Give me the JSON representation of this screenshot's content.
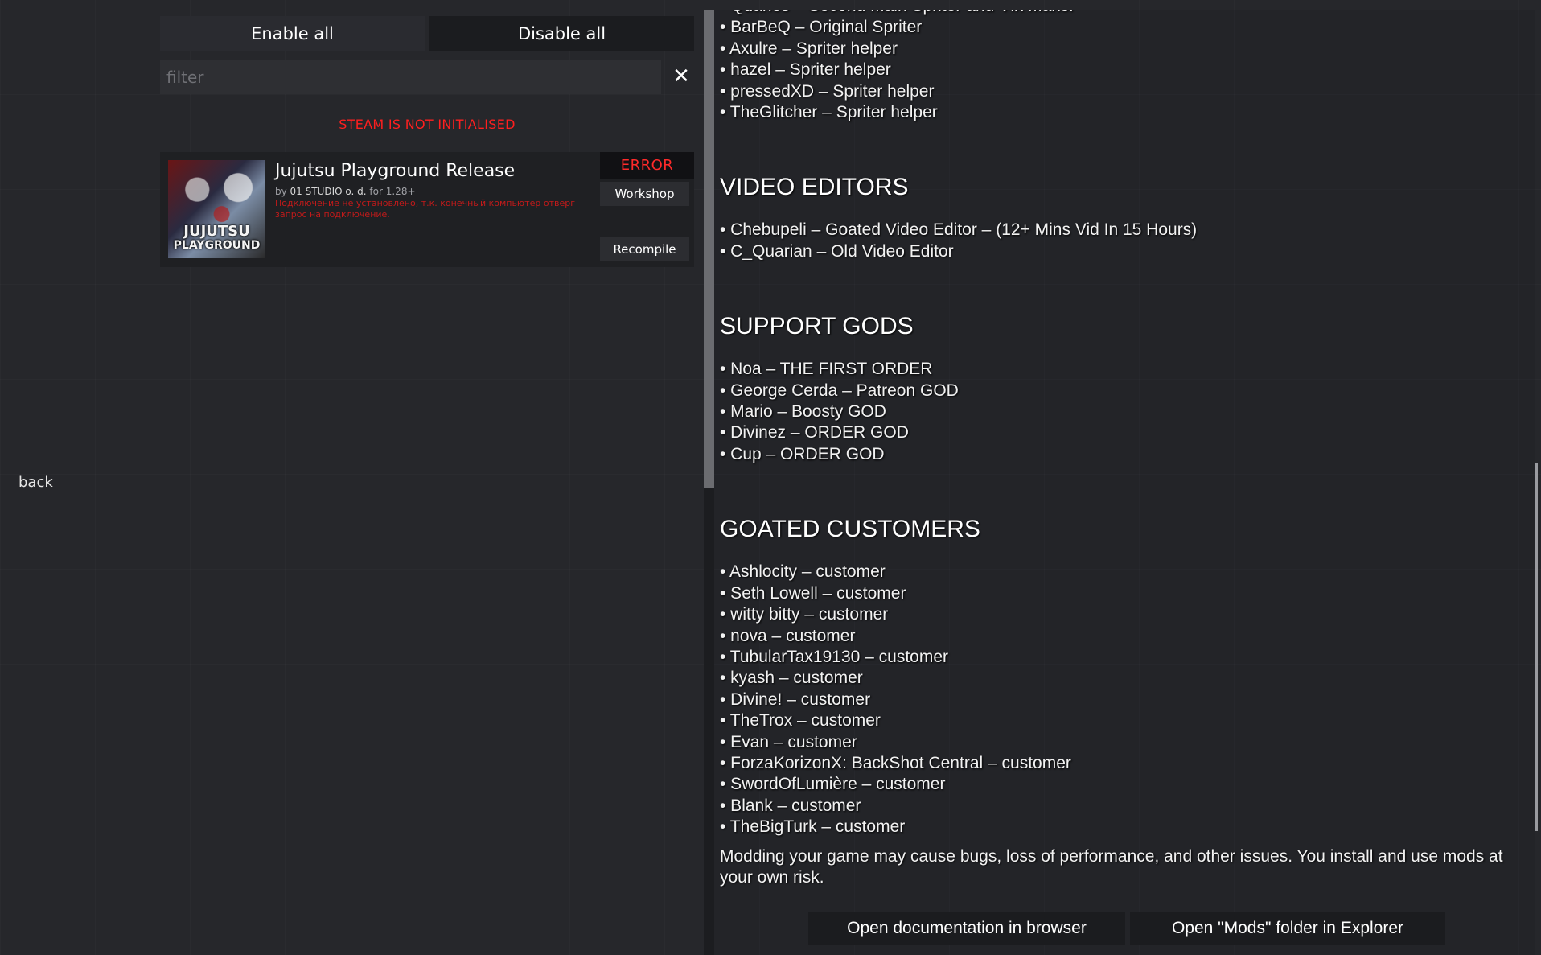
{
  "nav": {
    "back_label": "back"
  },
  "toolbar": {
    "enable_all": "Enable all",
    "disable_all": "Disable all"
  },
  "filter": {
    "placeholder": "filter",
    "clear_icon": "✕"
  },
  "steam_status": "STEAM IS NOT INITIALISED",
  "mod": {
    "title": "Jujutsu Playground Release",
    "by_prefix": "by",
    "author": "01 STUDIO o. d.",
    "version_note": "for 1.28+",
    "error_message": "Подключение не установлено, т.к. конечный компьютер отверг запрос на подключение.",
    "status_badge": "ERROR",
    "workshop_label": "Workshop",
    "recompile_label": "Recompile",
    "thumbnail_text_1": "JUJUTSU",
    "thumbnail_text_2": "PLAYGROUND",
    "thumbnail_icon": "mod-thumbnail-image"
  },
  "credits": {
    "top_lines": [
      "• Quaries – Second Main Spriter and Vfx Maker",
      "• BarBeQ – Original Spriter",
      "• Axulre – Spriter helper",
      "• hazel – Spriter helper",
      "• pressedXD – Spriter helper",
      "• TheGlitcher – Spriter helper"
    ],
    "video_editors_heading": "VIDEO EDITORS",
    "video_editors": [
      "• Chebupeli – Goated Video Editor – (12+ Mins Vid In 15 Hours)",
      "• C_Quarian – Old Video Editor"
    ],
    "support_gods_heading": "SUPPORT GODS",
    "support_gods": [
      "• Noa – THE FIRST ORDER",
      "• George Cerda – Patreon GOD",
      "• Mario – Boosty GOD",
      "• Divinez – ORDER GOD",
      "• Cup – ORDER GOD"
    ],
    "customers_heading": "GOATED CUSTOMERS",
    "customers": [
      "• Ashlocity – customer",
      "• Seth Lowell – customer",
      "• witty bitty – customer",
      "• nova – customer",
      "• TubularTax19130 – customer",
      "• kyash – customer",
      "• Divine! – customer",
      "• TheTrox – customer",
      "• Evan – customer",
      "• ForzaKorizonX: BackShot Central – customer",
      "• SwordOfLumière – customer",
      "• Blank – customer",
      "• TheBigTurk – customer"
    ]
  },
  "disclaimer": "Modding your game may cause bugs, loss of performance, and other issues. You install and use mods at your own risk.",
  "footer": {
    "open_docs": "Open documentation in browser",
    "open_mods_folder": "Open \"Mods\" folder in Explorer"
  },
  "colors": {
    "background": "#26272b",
    "error_red": "#ff2a2a",
    "panel_dark": "#1b1c1f"
  }
}
